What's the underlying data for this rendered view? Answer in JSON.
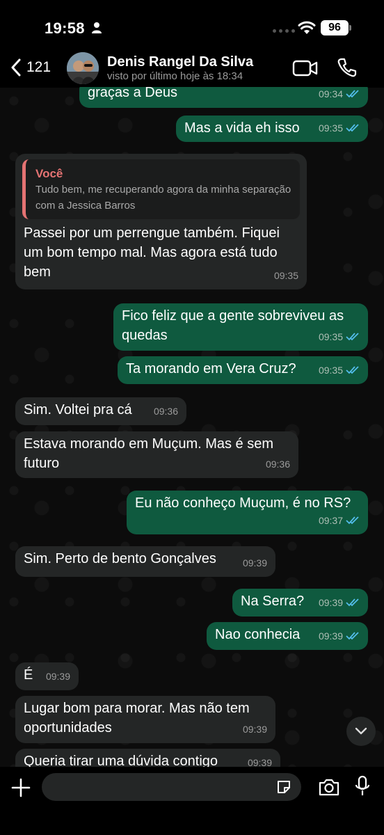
{
  "status_bar": {
    "time": "19:58",
    "battery": "96"
  },
  "header": {
    "back_count": "121",
    "contact_name": "Denis Rangel Da Silva",
    "contact_status": "visto por último hoje às 18:34"
  },
  "messages": [
    {
      "text": "graças a Deus",
      "time": "09:34"
    },
    {
      "text": "Mas a vida eh isso",
      "time": "09:35"
    },
    {
      "quote_author": "Você",
      "quote_text": "Tudo bem, me recuperando agora da minha separação com a Jessica Barros",
      "text": "Passei por um perrengue também. Fiquei um bom tempo mal. Mas agora está tudo bem",
      "time": "09:35"
    },
    {
      "text": "Fico feliz que a gente sobreviveu as quedas",
      "time": "09:35"
    },
    {
      "text": "Ta morando em Vera Cruz?",
      "time": "09:35"
    },
    {
      "text": "Sim. Voltei pra cá",
      "time": "09:36"
    },
    {
      "text": "Estava morando em Muçum. Mas é sem futuro",
      "time": "09:36"
    },
    {
      "text": "Eu não conheço Muçum, é no RS?",
      "time": "09:37"
    },
    {
      "text": "Sim. Perto de bento Gonçalves",
      "time": "09:39"
    },
    {
      "text": "Na Serra?",
      "time": "09:39"
    },
    {
      "text": "Nao conhecia",
      "time": "09:39"
    },
    {
      "text": "É",
      "time": "09:39"
    },
    {
      "text": "Lugar bom para morar. Mas não tem oportunidades",
      "time": "09:39"
    },
    {
      "text": "Queria tirar uma dúvida contigo",
      "time": "09:39"
    }
  ],
  "icons": {
    "person": "person-icon",
    "wifi": "wifi-icon",
    "back": "chevron-left-icon",
    "video": "video-camera-icon",
    "call": "phone-icon",
    "ticks": "double-check-icon",
    "scroll": "chevron-down-icon",
    "plus": "plus-icon",
    "sticker": "sticker-icon",
    "camera": "camera-icon",
    "mic": "microphone-icon"
  },
  "colors": {
    "outgoing_bubble": "#0f5a3f",
    "incoming_bubble": "#242626",
    "read_ticks": "#53bdeb",
    "quote_accent": "#e57373"
  }
}
